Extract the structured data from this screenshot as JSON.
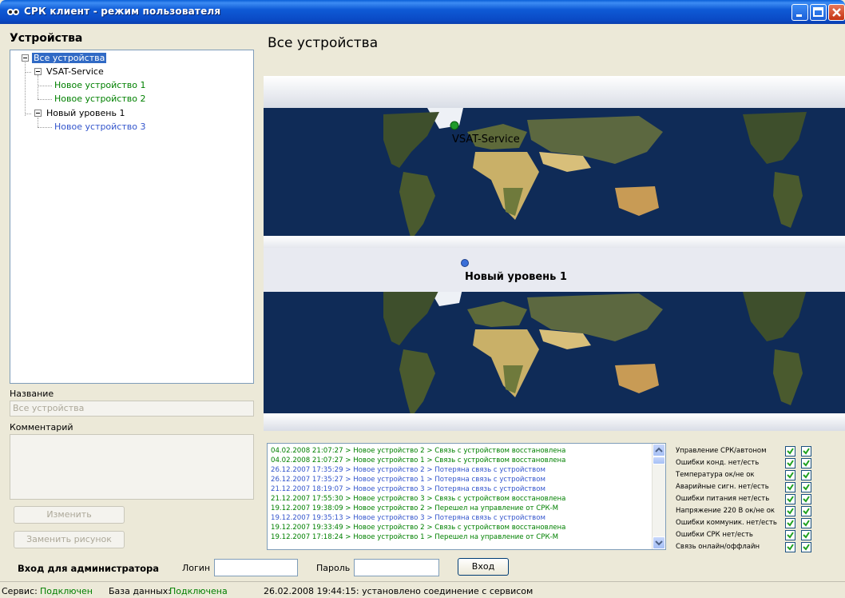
{
  "window": {
    "title": "СРК клиент - режим пользователя"
  },
  "left": {
    "devices_title": "Устройства",
    "tree": [
      {
        "label": "Все устройства",
        "level": 0,
        "color": "selected"
      },
      {
        "label": "VSAT-Service",
        "level": 1,
        "color": "black"
      },
      {
        "label": "Новое устройство 1",
        "level": 2,
        "color": "green"
      },
      {
        "label": "Новое устройство 2",
        "level": 2,
        "color": "green"
      },
      {
        "label": "Новый уровень 1",
        "level": 1,
        "color": "black"
      },
      {
        "label": "Новое устройство 3",
        "level": 2,
        "color": "blue"
      }
    ],
    "name_label": "Название",
    "name_value": "Все устройства",
    "comment_label": "Комментарий",
    "edit_button": "Изменить",
    "replace_image_button": "Заменить рисунок"
  },
  "main": {
    "title": "Все устройства",
    "map_markers": [
      {
        "label": "VSAT-Service",
        "color": "#1f9a2b"
      },
      {
        "label": "Новый уровень 1",
        "color": "#3a6fd8"
      }
    ]
  },
  "log": [
    {
      "text": "04.02.2008 21:07:27 > Новое устройство 2 > Связь с устройством восстановлена",
      "color": "green"
    },
    {
      "text": "04.02.2008 21:07:27 > Новое устройство 1 > Связь с устройством восстановлена",
      "color": "green"
    },
    {
      "text": "26.12.2007 17:35:29 > Новое устройство 2 > Потеряна связь с устройством",
      "color": "blue"
    },
    {
      "text": "26.12.2007 17:35:27 > Новое устройство 1 > Потеряна связь с устройством",
      "color": "blue"
    },
    {
      "text": "21.12.2007 18:19:07 > Новое устройство 3 > Потеряна связь с устройством",
      "color": "blue"
    },
    {
      "text": "21.12.2007 17:55:30 > Новое устройство 3 > Связь с устройством восстановлена",
      "color": "green"
    },
    {
      "text": "19.12.2007 19:38:09 > Новое устройство 2 > Перешел на управление от СРК-М",
      "color": "green"
    },
    {
      "text": "19.12.2007 19:35:13 > Новое устройство 3 > Потеряна связь с устройством",
      "color": "blue"
    },
    {
      "text": "19.12.2007 19:33:49 > Новое устройство 2 > Связь с устройством восстановлена",
      "color": "green"
    },
    {
      "text": "19.12.2007 17:18:24 > Новое устройство 1 > Перешел на управление от СРК-М",
      "color": "green"
    }
  ],
  "status_panel": [
    {
      "label": "Управление СРК/автоном",
      "checks": [
        true,
        true
      ]
    },
    {
      "label": "Ошибки конд. нет/есть",
      "checks": [
        true,
        true
      ]
    },
    {
      "label": "Температура ок/не ок",
      "checks": [
        true,
        true
      ]
    },
    {
      "label": "Аварийные сигн. нет/есть",
      "checks": [
        true,
        true
      ]
    },
    {
      "label": "Ошибки питания нет/есть",
      "checks": [
        true,
        true
      ]
    },
    {
      "label": "Напряжение 220 В ок/не ок",
      "checks": [
        true,
        true
      ]
    },
    {
      "label": "Ошибки коммуник. нет/есть",
      "checks": [
        true,
        true
      ]
    },
    {
      "label": "Ошибки СРК нет/есть",
      "checks": [
        true,
        true
      ]
    },
    {
      "label": "Связь онлайн/оффлайн",
      "checks": [
        true,
        true
      ]
    }
  ],
  "admin": {
    "title": "Вход для администратора",
    "login_label": "Логин",
    "login_value": "",
    "password_label": "Пароль",
    "password_value": "",
    "login_button": "Вход"
  },
  "statusbar": {
    "service_label": "Сервис:",
    "service_value": "Подключен",
    "db_label": "База данных:",
    "db_value": "Подключена",
    "message": "26.02.2008 19:44:15: установлено соединение с сервисом"
  }
}
